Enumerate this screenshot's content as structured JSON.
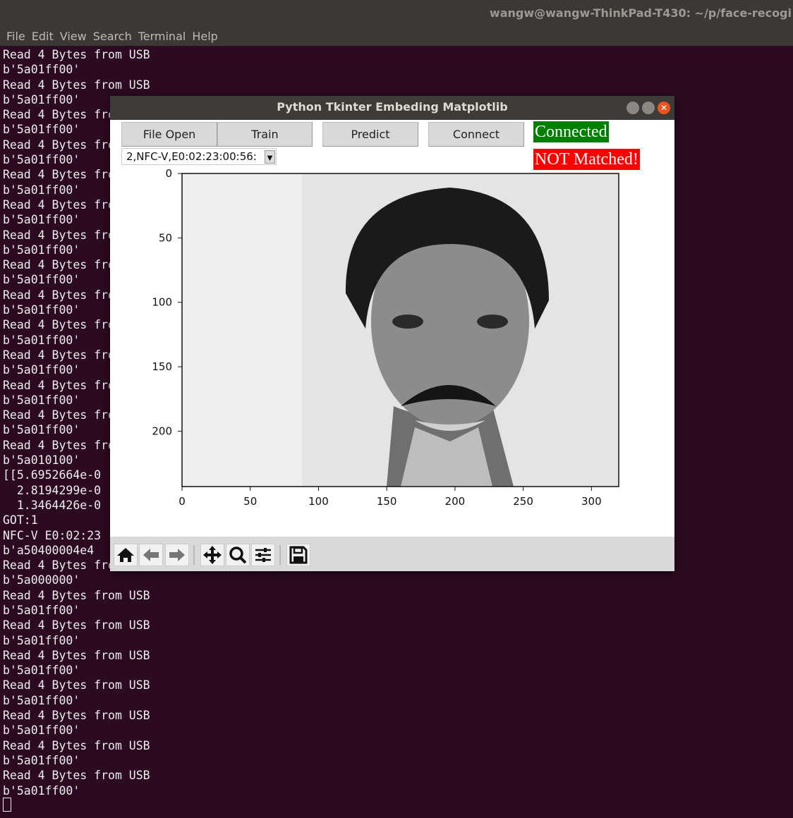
{
  "terminal": {
    "title": "wangw@wangw-ThinkPad-T430: ~/p/face-recogi",
    "menu": [
      "File",
      "Edit",
      "View",
      "Search",
      "Terminal",
      "Help"
    ],
    "lines": [
      "Read 4 Bytes from USB",
      "b'5a01ff00'",
      "Read 4 Bytes from USB",
      "b'5a01ff00'",
      "Read 4 Bytes from USB",
      "b'5a01ff00'",
      "Read 4 Bytes from USB",
      "b'5a01ff00'",
      "Read 4 Bytes from USB",
      "b'5a01ff00'",
      "Read 4 Bytes from USB",
      "b'5a01ff00'",
      "Read 4 Bytes from USB",
      "b'5a01ff00'",
      "Read 4 Bytes from USB",
      "b'5a01ff00'",
      "Read 4 Bytes from USB",
      "b'5a01ff00'",
      "Read 4 Bytes from USB",
      "b'5a01ff00'",
      "Read 4 Bytes from USB",
      "b'5a01ff00'",
      "Read 4 Bytes from USB",
      "b'5a01ff00'",
      "Read 4 Bytes from USB",
      "b'5a01ff00'",
      "Read 4 Bytes from USB",
      "b'5a010100'",
      "[[5.6952664e-0",
      "  2.8194299e-0",
      "  1.3464426e-0",
      "GOT:1",
      "NFC-V E0:02:23",
      "b'a50400004e4",
      "Read 4 Bytes from USB",
      "b'5a000000'",
      "Read 4 Bytes from USB",
      "b'5a01ff00'",
      "Read 4 Bytes from USB",
      "b'5a01ff00'",
      "Read 4 Bytes from USB",
      "b'5a01ff00'",
      "Read 4 Bytes from USB",
      "b'5a01ff00'",
      "Read 4 Bytes from USB",
      "b'5a01ff00'",
      "Read 4 Bytes from USB",
      "b'5a01ff00'",
      "Read 4 Bytes from USB",
      "b'5a01ff00'"
    ]
  },
  "window": {
    "title": "Python Tkinter Embeding Matplotlib",
    "buttons": {
      "file_open": "File Open",
      "train": "Train",
      "predict": "Predict",
      "connect": "Connect"
    },
    "combo_value": "2,NFC-V,E0:02:23:00:56:",
    "status_connected": "Connected",
    "status_connected_color": "#008000",
    "status_match": "NOT Matched!",
    "status_match_color": "#ff0000",
    "plot": {
      "xticks": [
        "0",
        "50",
        "100",
        "150",
        "200",
        "250",
        "300"
      ],
      "yticks": [
        "0",
        "50",
        "100",
        "150",
        "200"
      ],
      "image_width": 320,
      "image_height": 243,
      "image": "grayscale face photo"
    },
    "toolbar": [
      "home-icon",
      "back-icon",
      "forward-icon",
      "pan-icon",
      "zoom-icon",
      "configure-icon",
      "save-icon"
    ]
  }
}
